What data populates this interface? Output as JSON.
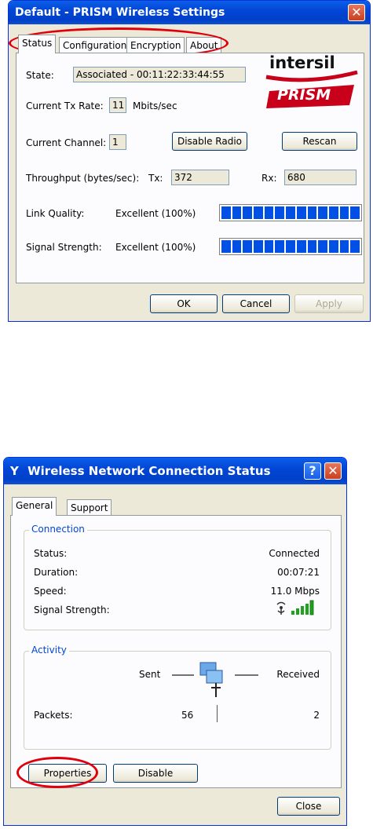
{
  "prism": {
    "title": "Default - PRISM Wireless Settings",
    "tabs": [
      "Status",
      "Configuration",
      "Encryption",
      "About"
    ],
    "logo_top": "intersil",
    "logo_bottom": "PRISM",
    "state_label": "State:",
    "state_value": "Associated - 00:11:22:33:44:55",
    "tx_rate_label": "Current Tx Rate:",
    "tx_rate_value": "11",
    "tx_rate_unit": "Mbits/sec",
    "channel_label": "Current Channel:",
    "channel_value": "1",
    "disable_radio": "Disable Radio",
    "rescan": "Rescan",
    "throughput_label": "Throughput (bytes/sec):",
    "tx_label": "Tx:",
    "tx_value": "372",
    "rx_label": "Rx:",
    "rx_value": "680",
    "link_quality_label": "Link Quality:",
    "link_quality_value": "Excellent (100%)",
    "link_quality_level": 1.0,
    "signal_strength_label": "Signal Strength:",
    "signal_strength_value": "Excellent (100%)",
    "signal_strength_level": 1.0,
    "ok": "OK",
    "cancel": "Cancel",
    "apply": "Apply"
  },
  "wnc": {
    "title": "Wireless Network Connection Status",
    "tabs": [
      "General",
      "Support"
    ],
    "connection_group": "Connection",
    "status_label": "Status:",
    "status_value": "Connected",
    "duration_label": "Duration:",
    "duration_value": "00:07:21",
    "speed_label": "Speed:",
    "speed_value": "11.0 Mbps",
    "signal_label": "Signal Strength:",
    "signal_bars": 5,
    "activity_group": "Activity",
    "sent_label": "Sent",
    "received_label": "Received",
    "packets_label": "Packets:",
    "packets_sent": "56",
    "packets_received": "2",
    "properties": "Properties",
    "disable": "Disable",
    "close": "Close"
  },
  "colors": {
    "annotation_oval": "#e0000c",
    "titlebar": "#0346d6",
    "bar_fill": "#0050e6",
    "signal_green": "#1fa31f"
  }
}
